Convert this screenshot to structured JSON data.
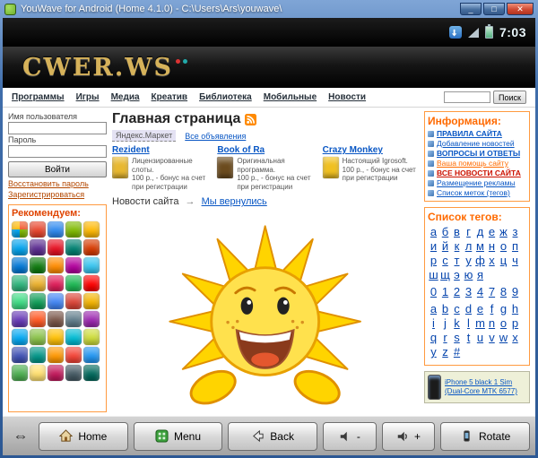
{
  "window": {
    "title": "YouWave for Android (Home 4.1.0) - C:\\Users\\Ars\\youwave\\"
  },
  "icons": {
    "minimize": "_",
    "maximize": "□",
    "close": "✕",
    "panel_toggle": "⇔"
  },
  "android": {
    "time": "7:03"
  },
  "header": {
    "logo": "CWER.WS"
  },
  "nav": {
    "items": [
      "Программы",
      "Игры",
      "Медиа",
      "Креатив",
      "Библиотека",
      "Мобильные",
      "Новости"
    ],
    "search_button": "Поиск"
  },
  "login": {
    "username_label": "Имя пользователя",
    "password_label": "Пароль",
    "login_button": "Войти",
    "restore_link": "Восстановить пароль",
    "register_link": "Зарегистрироваться"
  },
  "recommend": {
    "title": "Рекомендуем:",
    "icon_colors": [
      "windows",
      "#e8452c",
      "#2d89ef",
      "#7fba00",
      "#ffb900",
      "#00a4ef",
      "#5c2d91",
      "#e81123",
      "#008272",
      "#d83b01",
      "#0078d7",
      "#107c10",
      "#ff8c00",
      "#b4009e",
      "#36c5f0",
      "#2eb67d",
      "#ecb22e",
      "#e01e5a",
      "#1db954",
      "#ff0000",
      "#3ddc84",
      "#0f9d58",
      "#4285f4",
      "#db4437",
      "#f4b400",
      "#673ab7",
      "#ff5722",
      "#795548",
      "#607d8b",
      "#9c27b0",
      "#03a9f4",
      "#8bc34a",
      "#ffc107",
      "#00bcd4",
      "#cddc39",
      "#3f51b5",
      "#009688",
      "#ff9800",
      "#f44336",
      "#2196f3",
      "#4caf50",
      "#ffe070",
      "#c2185b",
      "#455a64",
      "#00695c"
    ]
  },
  "main": {
    "title": "Главная страница",
    "market_link": "Яндекс.Маркет",
    "ads_link": "Все объявления",
    "ads": [
      {
        "title": "Rezident",
        "line1": "Лицензированные слоты.",
        "line2": "100 р., - бонус на счет при регистрации",
        "thumb_color": "#e8b830"
      },
      {
        "title": "Book of Ra",
        "line1": "Оригинальная программа.",
        "line2": "100 р., - бонус на счет при регистрации",
        "thumb_color": "#6b4b1e"
      },
      {
        "title": "Crazy Monkey",
        "line1": "Настоящий Igrosoft.",
        "line2": "100 р., - бонус на счет при регистрации",
        "thumb_color": "#f0c020"
      }
    ],
    "news_label": "Новости сайта",
    "news_arrow": "→",
    "news_link": "Мы вернулись"
  },
  "info": {
    "title": "Информация:",
    "links": [
      {
        "label": "ПРАВИЛА САЙТА",
        "color": "#0856c4",
        "bold": true
      },
      {
        "label": "Добавление новостей",
        "color": "#0856c4",
        "bold": false
      },
      {
        "label": "ВОПРОСЫ И ОТВЕТЫ",
        "color": "#0856c4",
        "bold": true
      },
      {
        "label": "Ваша помощь сайту",
        "color": "#ff6a00",
        "bold": false
      },
      {
        "label": "ВСЕ НОВОСТИ САЙТА",
        "color": "#cc1100",
        "bold": true
      },
      {
        "label": "Размещение рекламы",
        "color": "#0856c4",
        "bold": false
      },
      {
        "label": "Список меток (тегов)",
        "color": "#0856c4",
        "bold": false
      }
    ]
  },
  "tags": {
    "title": "Список тегов:",
    "cyrillic": [
      "а",
      "б",
      "в",
      "г",
      "д",
      "е",
      "ж",
      "з",
      "и",
      "й",
      "к",
      "л",
      "м",
      "н",
      "о",
      "п",
      "р",
      "с",
      "т",
      "у",
      "ф",
      "х",
      "ц",
      "ч",
      "ш",
      "щ",
      "э",
      "ю",
      "я"
    ],
    "digits": [
      "0",
      "1",
      "2",
      "3",
      "4",
      "7",
      "8",
      "9"
    ],
    "latin": [
      "a",
      "b",
      "c",
      "d",
      "e",
      "f",
      "g",
      "h",
      "i",
      "j",
      "k",
      "l",
      "m",
      "n",
      "o",
      "p",
      "q",
      "r",
      "s",
      "t",
      "u",
      "v",
      "w",
      "x",
      "y",
      "z",
      "#"
    ]
  },
  "iphone_ad": {
    "text": "iPhone 5 black 1 Sim (Dual-Core MTK 6577)"
  },
  "toolbar": {
    "home": "Home",
    "menu": "Menu",
    "back": "Back",
    "vol_down": "-",
    "vol_up": "+",
    "rotate": "Rotate"
  }
}
